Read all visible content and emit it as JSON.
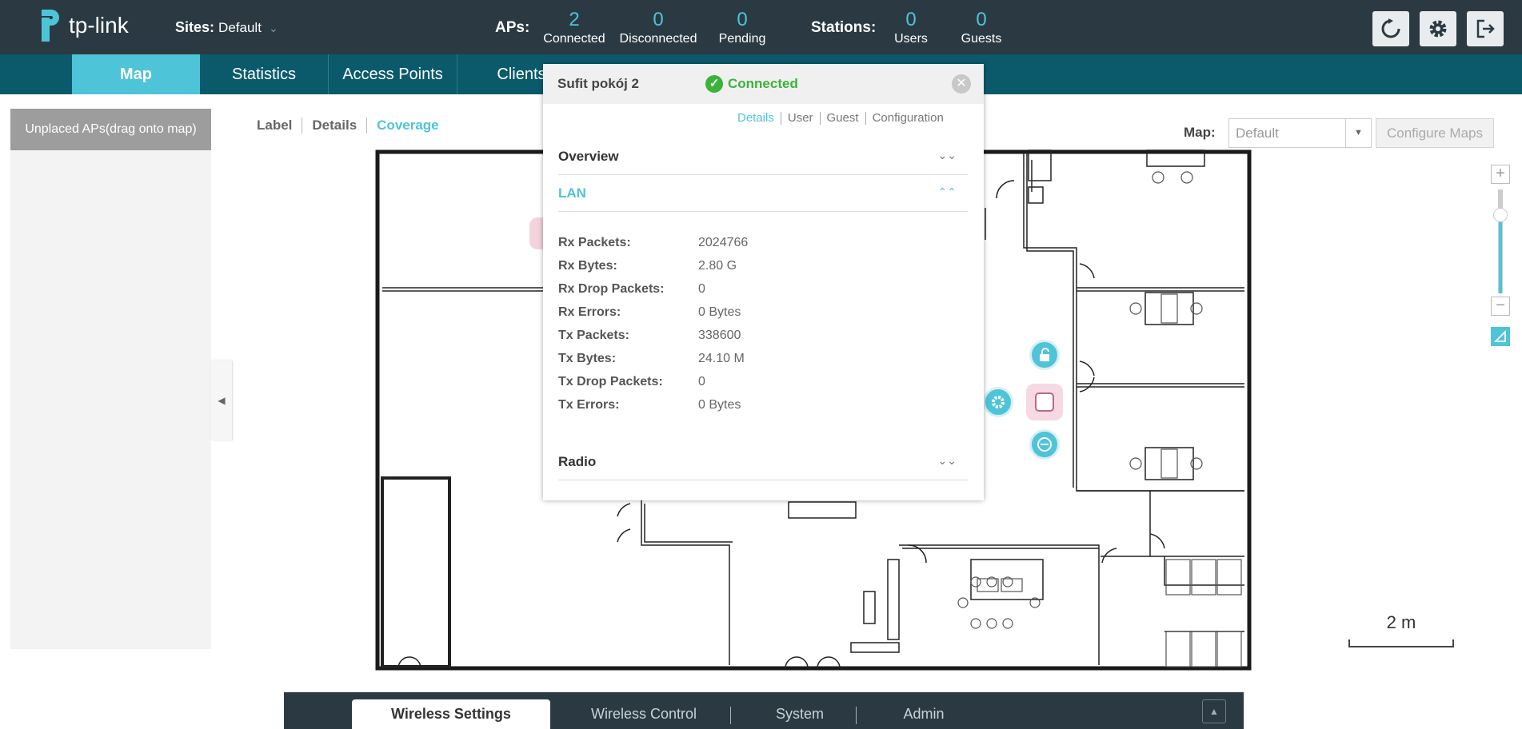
{
  "header": {
    "logo_text": "tp-link",
    "sites_label": "Sites:",
    "sites_value": "Default",
    "aps_label": "APs:",
    "aps": [
      {
        "value": "2",
        "label": "Connected"
      },
      {
        "value": "0",
        "label": "Disconnected"
      },
      {
        "value": "0",
        "label": "Pending"
      }
    ],
    "stations_label": "Stations:",
    "stations": [
      {
        "value": "0",
        "label": "Users"
      },
      {
        "value": "0",
        "label": "Guests"
      }
    ],
    "icons": [
      "refresh-icon",
      "gear-icon",
      "logout-icon"
    ]
  },
  "nav": {
    "items": [
      "Map",
      "Statistics",
      "Access Points",
      "Clients"
    ],
    "active": "Map"
  },
  "left_panel": {
    "header": "Unplaced APs(drag onto map)"
  },
  "view_tabs": {
    "items": [
      "Label",
      "Details",
      "Coverage"
    ],
    "active": "Coverage"
  },
  "map_select": {
    "label": "Map:",
    "value": "Default",
    "configure_label": "Configure Maps"
  },
  "zoom": {
    "plus": "+",
    "minus": "−"
  },
  "scale": {
    "label": "2 m"
  },
  "popup": {
    "title": "Sufit pokój 2",
    "status": "Connected",
    "tabs": [
      "Details",
      "User",
      "Guest",
      "Configuration"
    ],
    "active_tab": "Details",
    "sections": {
      "overview": "Overview",
      "lan": "LAN",
      "radio": "Radio"
    },
    "lan_stats": [
      {
        "key": "Rx Packets:",
        "value": "2024766"
      },
      {
        "key": "Rx Bytes:",
        "value": "2.80 G"
      },
      {
        "key": "Rx Drop Packets:",
        "value": "0"
      },
      {
        "key": "Rx Errors:",
        "value": "0 Bytes"
      },
      {
        "key": "Tx Packets:",
        "value": "338600"
      },
      {
        "key": "Tx Bytes:",
        "value": "24.10 M"
      },
      {
        "key": "Tx Drop Packets:",
        "value": "0"
      },
      {
        "key": "Tx Errors:",
        "value": "0 Bytes"
      }
    ]
  },
  "bottom_tabs": {
    "items": [
      "Wireless Settings",
      "Wireless Control",
      "System",
      "Admin"
    ],
    "active": "Wireless Settings"
  },
  "colors": {
    "accent": "#4ec4d8",
    "header": "#2b3a42",
    "nav": "#0b5a6c",
    "connected": "#3bb33b"
  }
}
